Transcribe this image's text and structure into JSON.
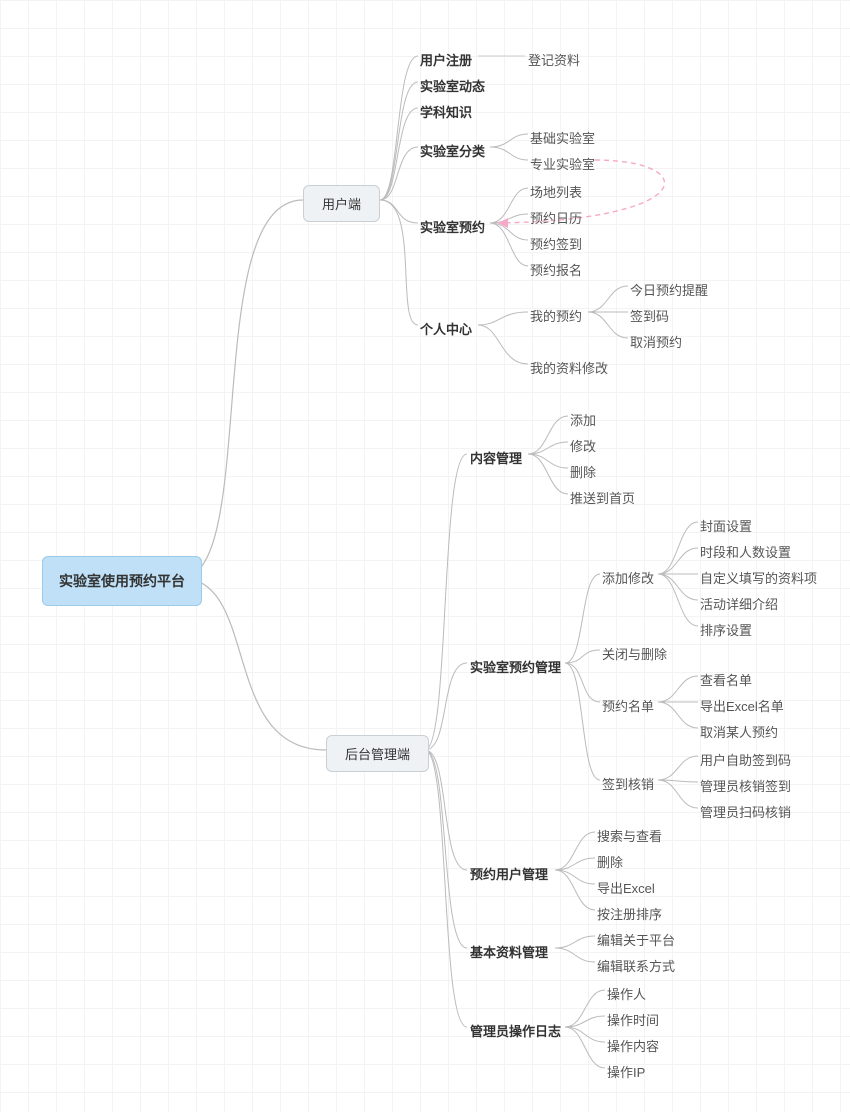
{
  "root": "实验室使用预约平台",
  "l1": {
    "client": "用户端",
    "admin": "后台管理端"
  },
  "client": {
    "reg": "用户注册",
    "reg_sub": "登记资料",
    "dyn": "实验室动态",
    "know": "学科知识",
    "cat": "实验室分类",
    "cat_base": "基础实验室",
    "cat_pro": "专业实验室",
    "appt": "实验室预约",
    "appt_list": "场地列表",
    "appt_cal": "预约日历",
    "appt_checkin": "预约签到",
    "appt_signup": "预约报名",
    "pc": "个人中心",
    "pc_my": "我的预约",
    "pc_my_today": "今日预约提醒",
    "pc_my_code": "签到码",
    "pc_my_cancel": "取消预约",
    "pc_edit": "我的资料修改"
  },
  "admin": {
    "content": "内容管理",
    "content_add": "添加",
    "content_mod": "修改",
    "content_del": "删除",
    "content_push": "推送到首页",
    "lab": "实验室预约管理",
    "lab_addmod": "添加修改",
    "lab_addmod_cover": "封面设置",
    "lab_addmod_slot": "时段和人数设置",
    "lab_addmod_custom": "自定义填写的资料项",
    "lab_addmod_detail": "活动详细介绍",
    "lab_addmod_sort": "排序设置",
    "lab_close": "关闭与删除",
    "lab_list": "预约名单",
    "lab_list_view": "查看名单",
    "lab_list_export": "导出Excel名单",
    "lab_list_cancel": "取消某人预约",
    "lab_checkin": "签到核销",
    "lab_checkin_self": "用户自助签到码",
    "lab_checkin_admin": "管理员核销签到",
    "lab_checkin_scan": "管理员扫码核销",
    "user": "预约用户管理",
    "user_search": "搜索与查看",
    "user_del": "删除",
    "user_export": "导出Excel",
    "user_sort": "按注册排序",
    "basic": "基本资料管理",
    "basic_about": "编辑关于平台",
    "basic_contact": "编辑联系方式",
    "log": "管理员操作日志",
    "log_op": "操作人",
    "log_time": "操作时间",
    "log_content": "操作内容",
    "log_ip": "操作IP"
  }
}
